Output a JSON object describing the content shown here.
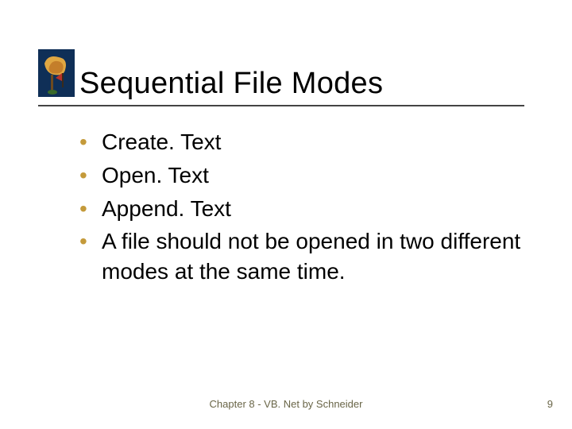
{
  "title": "Sequential File Modes",
  "bullets": [
    "Create. Text",
    "Open. Text",
    "Append. Text",
    "A file should not be opened in two different modes at the same time."
  ],
  "footer": "Chapter 8 - VB. Net by Schneider",
  "page_number": "9",
  "colors": {
    "bullet_accent": "#c49a3a",
    "rule": "#444444",
    "footer_text": "#6a6648"
  }
}
